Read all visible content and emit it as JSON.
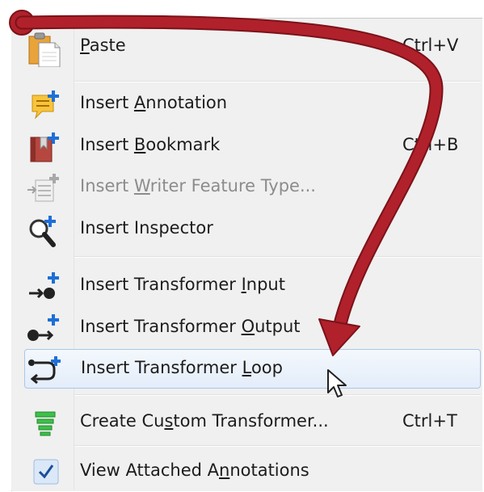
{
  "menu": {
    "items": [
      {
        "pre": "",
        "u": "P",
        "post": "aste",
        "shortcut": "Ctrl+V",
        "icon": "paste-icon",
        "disabled": false
      },
      {
        "pre": "Insert ",
        "u": "A",
        "post": "nnotation",
        "shortcut": "",
        "icon": "annotation-icon",
        "disabled": false
      },
      {
        "pre": "Insert ",
        "u": "B",
        "post": "ookmark",
        "shortcut": "Ctrl+B",
        "icon": "bookmark-icon",
        "disabled": false
      },
      {
        "pre": "Insert ",
        "u": "W",
        "post": "riter Feature Type...",
        "shortcut": "",
        "icon": "writer-feature-type-icon",
        "disabled": true
      },
      {
        "pre": "Insert Inspector",
        "u": "",
        "post": "",
        "shortcut": "",
        "icon": "inspector-icon",
        "disabled": false
      },
      {
        "pre": "Insert Transformer ",
        "u": "I",
        "post": "nput",
        "shortcut": "",
        "icon": "transformer-input-icon",
        "disabled": false
      },
      {
        "pre": "Insert Transformer ",
        "u": "O",
        "post": "utput",
        "shortcut": "",
        "icon": "transformer-output-icon",
        "disabled": false
      },
      {
        "pre": "Insert Transformer ",
        "u": "L",
        "post": "oop",
        "shortcut": "",
        "icon": "transformer-loop-icon",
        "disabled": false,
        "highlighted": true
      },
      {
        "pre": "Create Cu",
        "u": "s",
        "post": "tom Transformer...",
        "shortcut": "Ctrl+T",
        "icon": "custom-transformer-icon",
        "disabled": false
      },
      {
        "pre": "View Attached A",
        "u": "n",
        "post": "notations",
        "shortcut": "",
        "icon": "checkmark-icon",
        "disabled": false
      }
    ]
  },
  "colors": {
    "arrow": "#b0212b",
    "highlight_border": "#a9c7ec",
    "disabled_text": "#8c8c8c",
    "plus": "#1e6fd6"
  }
}
